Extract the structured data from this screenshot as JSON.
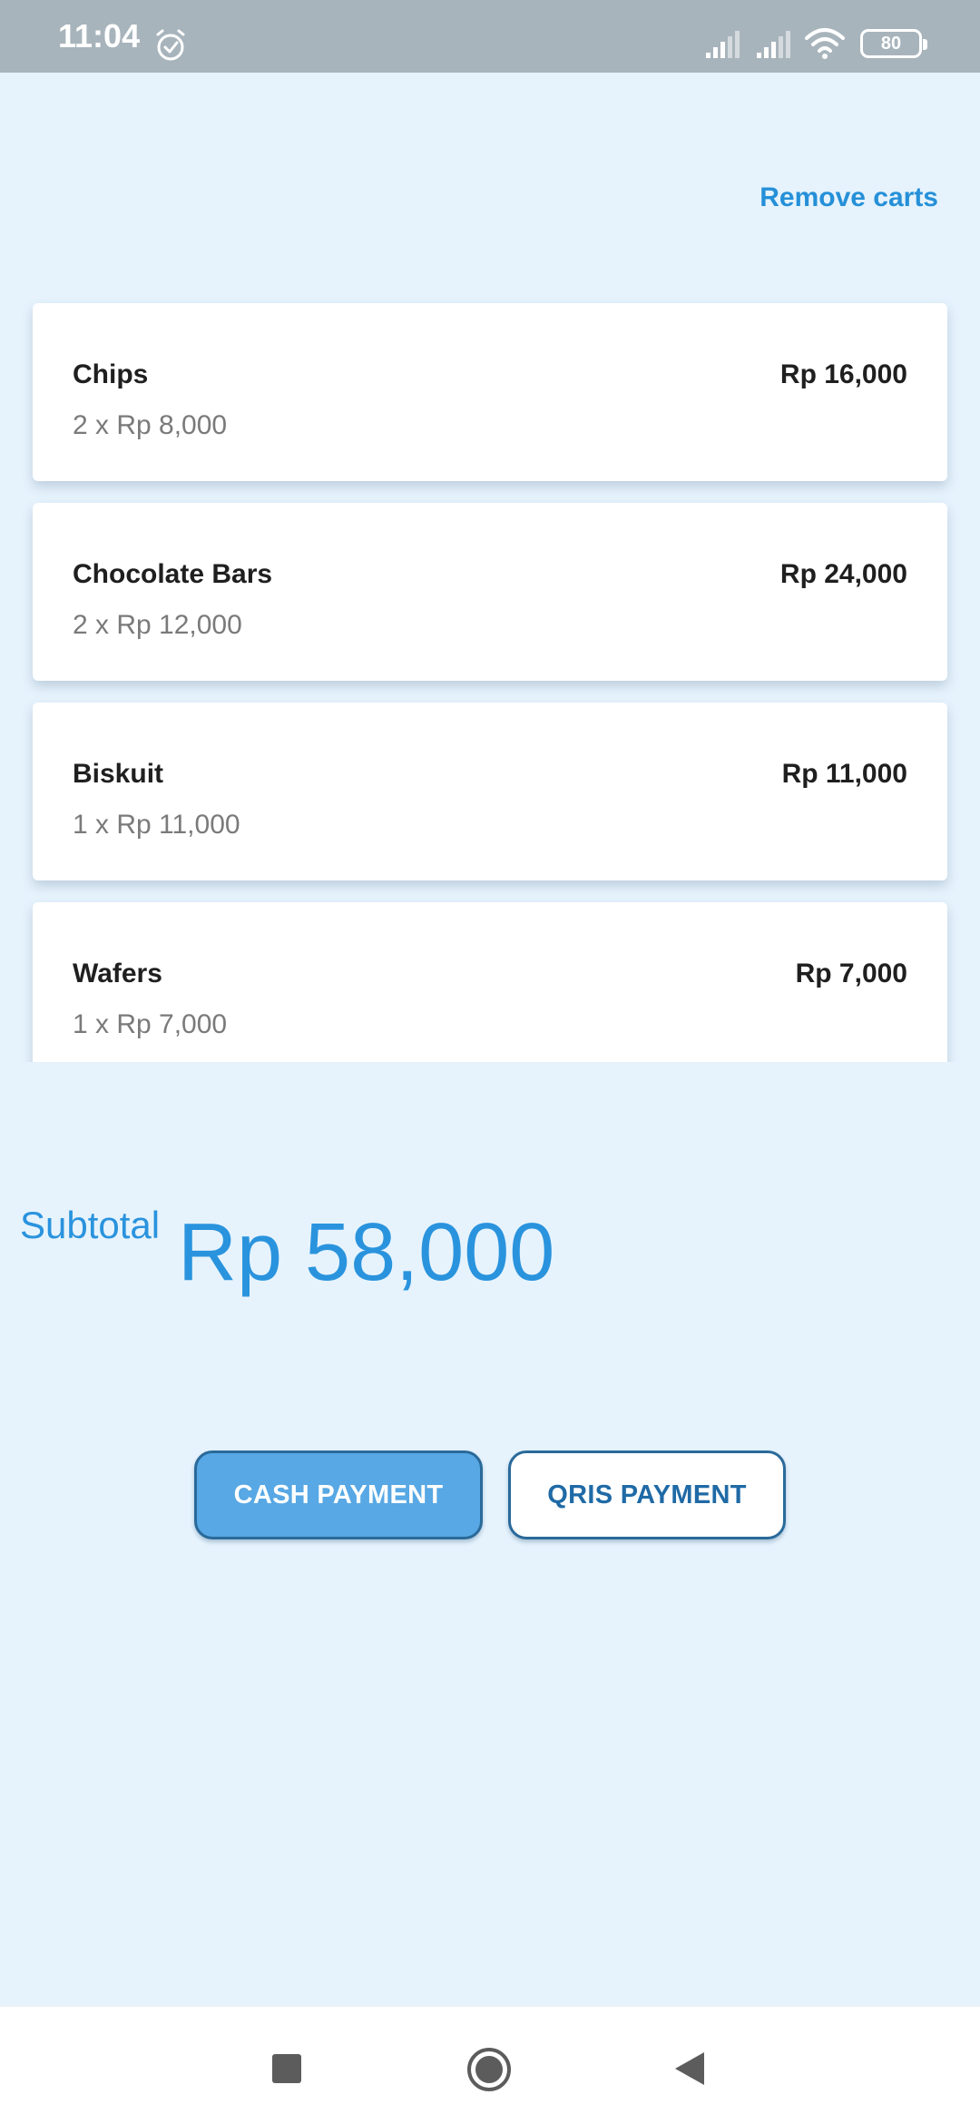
{
  "status_bar": {
    "time": "11:04",
    "battery": "80",
    "icons": [
      "alarm-icon",
      "signal-icon",
      "signal-icon",
      "wifi-icon",
      "battery-icon"
    ]
  },
  "header": {
    "remove_carts_label": "Remove carts"
  },
  "cart": {
    "items": [
      {
        "name": "Chips",
        "quantity_price": "2 x Rp 8,000",
        "total": "Rp 16,000"
      },
      {
        "name": "Chocolate Bars",
        "quantity_price": "2 x Rp 12,000",
        "total": "Rp 24,000"
      },
      {
        "name": "Biskuit",
        "quantity_price": "1 x Rp 11,000",
        "total": "Rp 11,000"
      },
      {
        "name": "Wafers",
        "quantity_price": "1 x Rp 7,000",
        "total": "Rp 7,000"
      }
    ]
  },
  "summary": {
    "subtotal_label": "Subtotal",
    "subtotal_value": "Rp 58,000"
  },
  "actions": {
    "cash_label": "CASH PAYMENT",
    "qris_label": "QRIS PAYMENT"
  },
  "navigation": {
    "icons": [
      "recent-apps-icon",
      "home-icon",
      "back-icon"
    ]
  },
  "colors": {
    "background": "#e6f3fd",
    "accent": "#2a93dd",
    "status_bar": "#a8b4bc",
    "cash_button": "#57a8e4",
    "button_border": "#2a6a9a"
  }
}
